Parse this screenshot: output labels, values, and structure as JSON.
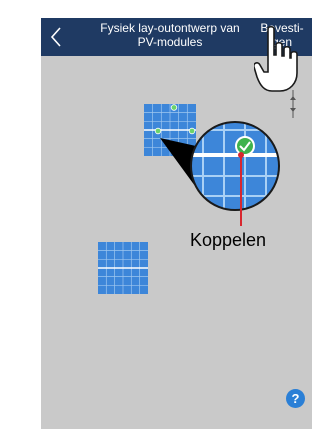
{
  "header": {
    "title": "Fysiek lay-outontwerp van\nPV-modules",
    "confirm_label": "Bevesti-\ngen",
    "back_icon": "chevron-left-icon"
  },
  "help": {
    "label": "?"
  },
  "callout": {
    "label": "Koppelen"
  },
  "colors": {
    "header_bg": "#1f3a63",
    "canvas_bg": "#c9c9c9",
    "module_blue": "#3d86d9",
    "check_green": "#3fb24c",
    "callout_red": "#d8272f",
    "help_blue": "#2a7fd6"
  }
}
